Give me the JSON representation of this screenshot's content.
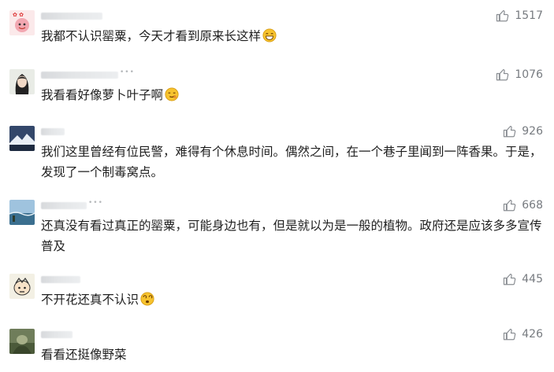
{
  "comments": [
    {
      "text": "我都不认识罂粟，今天才看到原来长这样",
      "likes": "1517",
      "emoji": "grin-emoji"
    },
    {
      "text": "我看看好像萝卜叶子啊",
      "likes": "1076",
      "emoji": "smirk-emoji"
    },
    {
      "text": "我们这里曾经有位民警，难得有个休息时间。偶然之间，在一个巷子里闻到一阵香果。于是，发现了一个制毒窝点。",
      "likes": "926"
    },
    {
      "text": "还真没有看过真正的罂粟，可能身边也有，但是就以为是一般的植物。政府还是应该多多宣传普及",
      "likes": "668"
    },
    {
      "text": "不开花还真不认识",
      "likes": "445",
      "emoji": "dizzy-emoji"
    },
    {
      "text": "看看还挺像野菜",
      "likes": "426"
    }
  ],
  "colors": {
    "like_icon": "#8a8e93",
    "text": "#1f1f1f",
    "count": "#777b80"
  }
}
